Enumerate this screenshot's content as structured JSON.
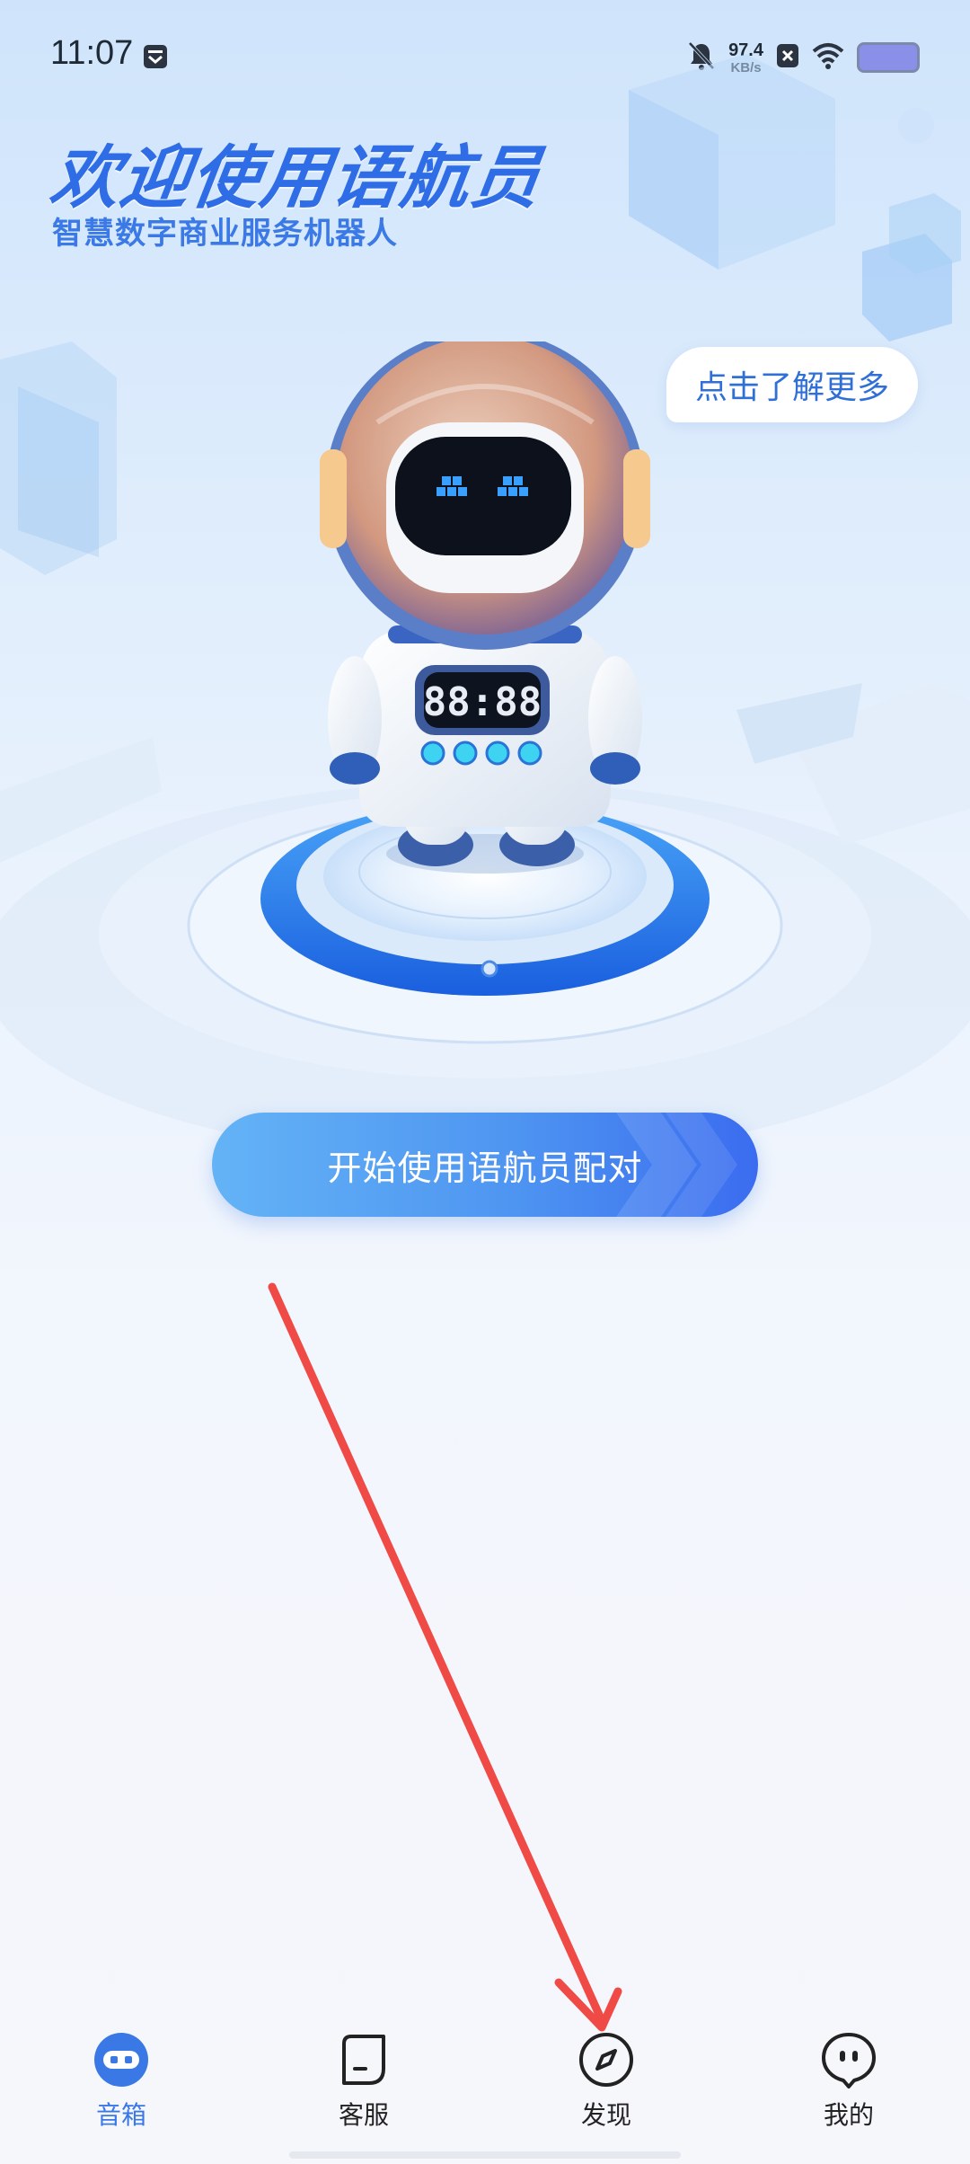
{
  "status_bar": {
    "time": "11:07",
    "net_speed_value": "97.4",
    "net_speed_unit": "KB/s",
    "icons": [
      "notification-box-icon",
      "mute-bell-icon",
      "close-badge-icon",
      "wifi-icon",
      "battery-icon"
    ]
  },
  "hero": {
    "title": "欢迎使用语航员",
    "subtitle": "智慧数字商业服务机器人",
    "learn_more": "点击了解更多",
    "robot_display": "88:88"
  },
  "actions": {
    "start_pairing": "开始使用语航员配对"
  },
  "nav": {
    "active_index": 0,
    "items": [
      {
        "label": "音箱",
        "icon": "speaker-robot-icon"
      },
      {
        "label": "客服",
        "icon": "chat-bubble-icon"
      },
      {
        "label": "发现",
        "icon": "compass-icon"
      },
      {
        "label": "我的",
        "icon": "profile-face-icon"
      }
    ]
  },
  "colors": {
    "accent": "#3a78e6",
    "title": "#2f6de6",
    "annotation_arrow": "#ef4a45"
  }
}
